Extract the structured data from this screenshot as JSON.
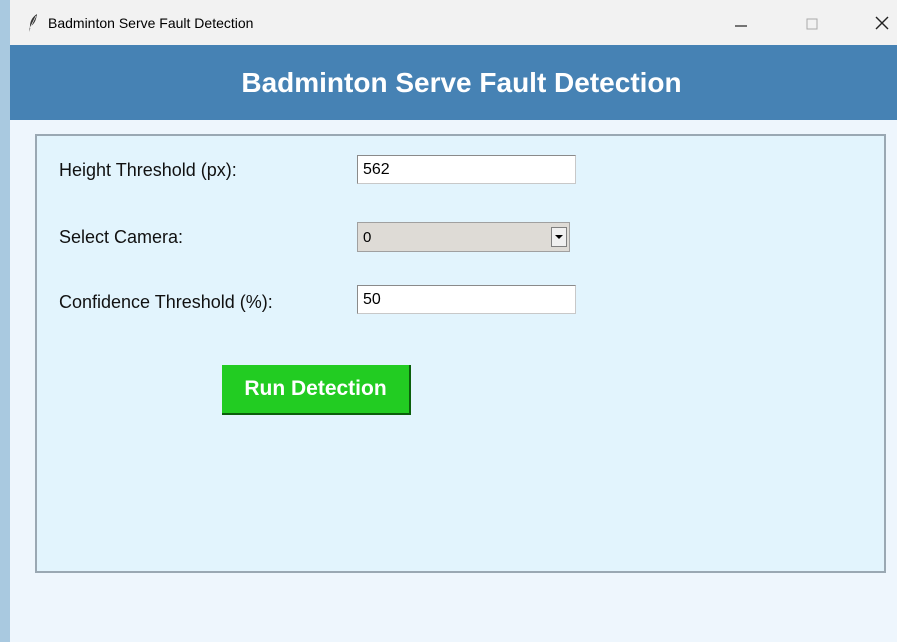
{
  "window": {
    "title": "Badminton Serve Fault Detection",
    "app_icon": "feather-icon",
    "controls": [
      "minimize-icon",
      "maximize-icon",
      "close-icon"
    ]
  },
  "header": {
    "title": "Badminton Serve Fault Detection",
    "background_color": "#4682b4"
  },
  "form": {
    "height_threshold": {
      "label": "Height Threshold (px):",
      "value": "562"
    },
    "camera": {
      "label": "Select Camera:",
      "value": "0"
    },
    "confidence_threshold": {
      "label": "Confidence Threshold (%):",
      "value": "50"
    }
  },
  "actions": {
    "run_label": "Run Detection",
    "run_color": "#22cc22"
  }
}
